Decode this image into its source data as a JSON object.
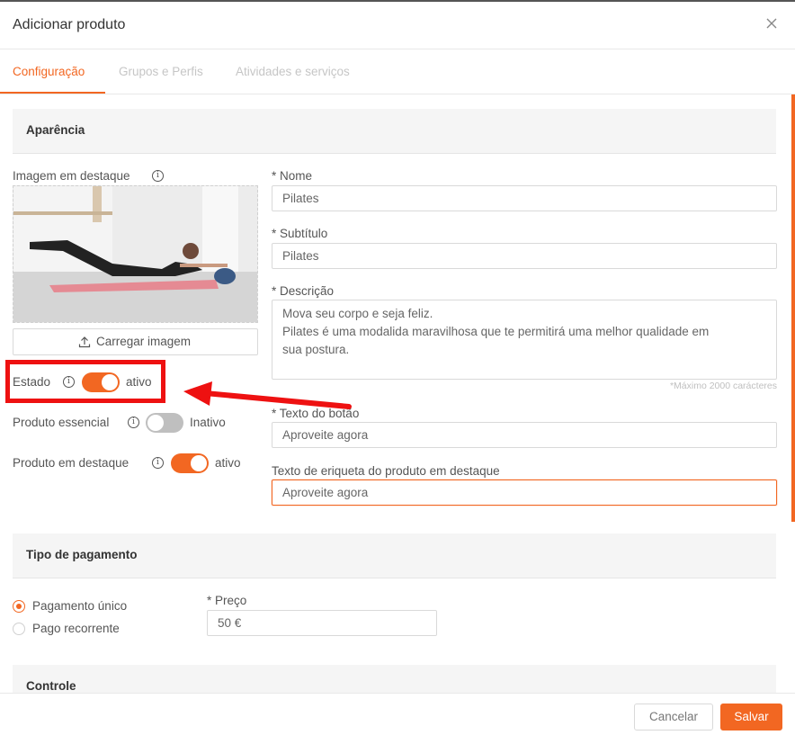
{
  "modal": {
    "title": "Adicionar produto",
    "close_icon": "close-icon"
  },
  "tabs": [
    {
      "label": "Configuração",
      "active": true
    },
    {
      "label": "Grupos e Perfis",
      "active": false
    },
    {
      "label": "Atividades e serviços",
      "active": false
    }
  ],
  "appearance": {
    "heading": "Aparência",
    "image_label": "Imagem em destaque",
    "upload_label": "Carregar imagem",
    "toggles": [
      {
        "label": "Estado",
        "state_label": "ativo",
        "on": true
      },
      {
        "label": "Produto essencial",
        "state_label": "Inativo",
        "on": false
      },
      {
        "label": "Produto em destaque",
        "state_label": "ativo",
        "on": true
      }
    ],
    "fields": {
      "name_label": "* Nome",
      "name_value": "Pilates",
      "subtitle_label": "* Subtítulo",
      "subtitle_value": "Pilates",
      "description_label": "* Descrição",
      "description_lines": [
        "Mova seu corpo e seja feliz.",
        "Pilates é uma modalida maravilhosa que te permitirá uma melhor qualidade em",
        "sua postura."
      ],
      "description_counter": "*Máximo 2000 carácteres",
      "button_text_label": "* Texto do botão",
      "button_text_value": "Aproveite agora",
      "tag_label": "Texto de eriqueta do produto em destaque",
      "tag_value": "Aproveite agora"
    }
  },
  "payment": {
    "heading": "Tipo de pagamento",
    "options": [
      {
        "label": "Pagamento único",
        "checked": true
      },
      {
        "label": "Pago recorrente",
        "checked": false
      }
    ],
    "price_label": "* Preço",
    "price_value": "50 €"
  },
  "control": {
    "heading": "Controle"
  },
  "footer": {
    "cancel_label": "Cancelar",
    "save_label": "Salvar"
  },
  "colors": {
    "accent": "#f26722",
    "annotation": "#ee1111"
  }
}
